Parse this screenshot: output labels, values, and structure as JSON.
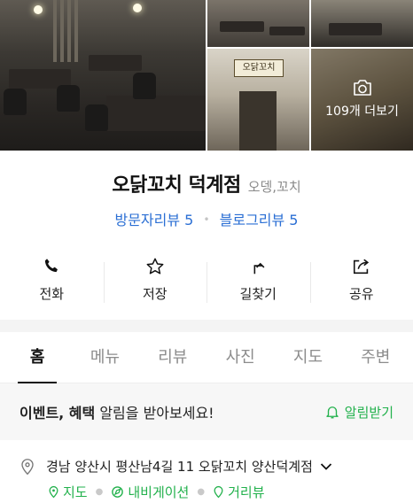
{
  "gallery": {
    "more_label": "109개 더보기",
    "sign_text": "오닭꼬치"
  },
  "place": {
    "name": "오닭꼬치 덕계점",
    "category": "오뎅,꼬치",
    "visitor_reviews": "방문자리뷰 5",
    "blog_reviews": "블로그리뷰 5"
  },
  "actions": [
    {
      "label": "전화",
      "icon": "phone-icon"
    },
    {
      "label": "저장",
      "icon": "star-icon"
    },
    {
      "label": "길찾기",
      "icon": "directions-icon"
    },
    {
      "label": "공유",
      "icon": "share-icon"
    }
  ],
  "tabs": [
    "홈",
    "메뉴",
    "리뷰",
    "사진",
    "지도",
    "주변"
  ],
  "notice": {
    "bold": "이벤트, 혜택",
    "text": " 알림을 받아보세요!",
    "button": "알림받기"
  },
  "address": {
    "text": "경남 양산시 평산남4길 11 오닭꼬치 양산덕계점",
    "links": [
      "지도",
      "내비게이션",
      "거리뷰"
    ]
  },
  "colors": {
    "accent_green": "#22b14c",
    "link_blue": "#2b6fd4"
  }
}
